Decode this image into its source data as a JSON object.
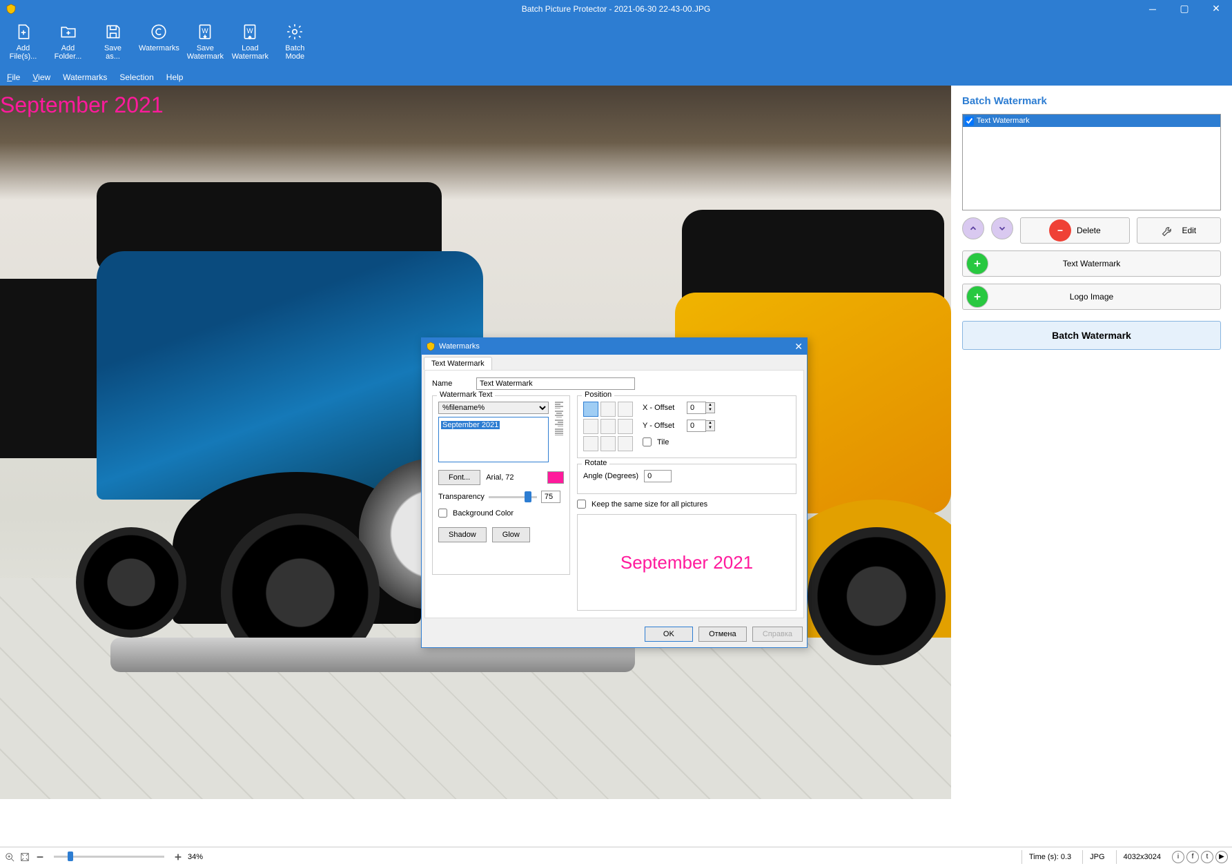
{
  "title": "Batch Picture Protector - 2021-06-30 22-43-00.JPG",
  "ribbon": [
    {
      "label": "Add\nFile(s)..."
    },
    {
      "label": "Add\nFolder..."
    },
    {
      "label": "Save\nas..."
    },
    {
      "label": "Watermarks"
    },
    {
      "label": "Save\nWatermark"
    },
    {
      "label": "Load\nWatermark"
    },
    {
      "label": "Batch\nMode"
    }
  ],
  "menu": [
    "File",
    "View",
    "Watermarks",
    "Selection",
    "Help"
  ],
  "canvas_watermark": "September 2021",
  "sidebar": {
    "heading": "Batch Watermark",
    "list_item": "Text Watermark",
    "delete_label": "Delete",
    "edit_label": "Edit",
    "text_wm_label": "Text Watermark",
    "logo_label": "Logo Image",
    "batch_btn": "Batch Watermark"
  },
  "dialog": {
    "title": "Watermarks",
    "tab": "Text Watermark",
    "name_label": "Name",
    "name_value": "Text Watermark",
    "wm_text_label": "Watermark Text",
    "wm_combo": "%filename%",
    "wm_text_value": "September 2021",
    "font_btn": "Font...",
    "font_desc": "Arial, 72",
    "transparency_label": "Transparency",
    "transparency_value": "75",
    "bgcolor_label": "Background Color",
    "shadow_btn": "Shadow",
    "glow_btn": "Glow",
    "position_label": "Position",
    "xoffset_label": "X - Offset",
    "yoffset_label": "Y - Offset",
    "xoffset_val": "0",
    "yoffset_val": "0",
    "tile_label": "Tile",
    "rotate_label": "Rotate",
    "angle_label": "Angle (Degrees)",
    "angle_val": "0",
    "keepsize_label": "Keep the same size for all pictures",
    "preview_text": "September 2021",
    "ok": "OK",
    "cancel": "Отмена",
    "help": "Справка"
  },
  "status": {
    "zoom": "34%",
    "time": "Time (s): 0.3",
    "fmt": "JPG",
    "dims": "4032x3024"
  }
}
